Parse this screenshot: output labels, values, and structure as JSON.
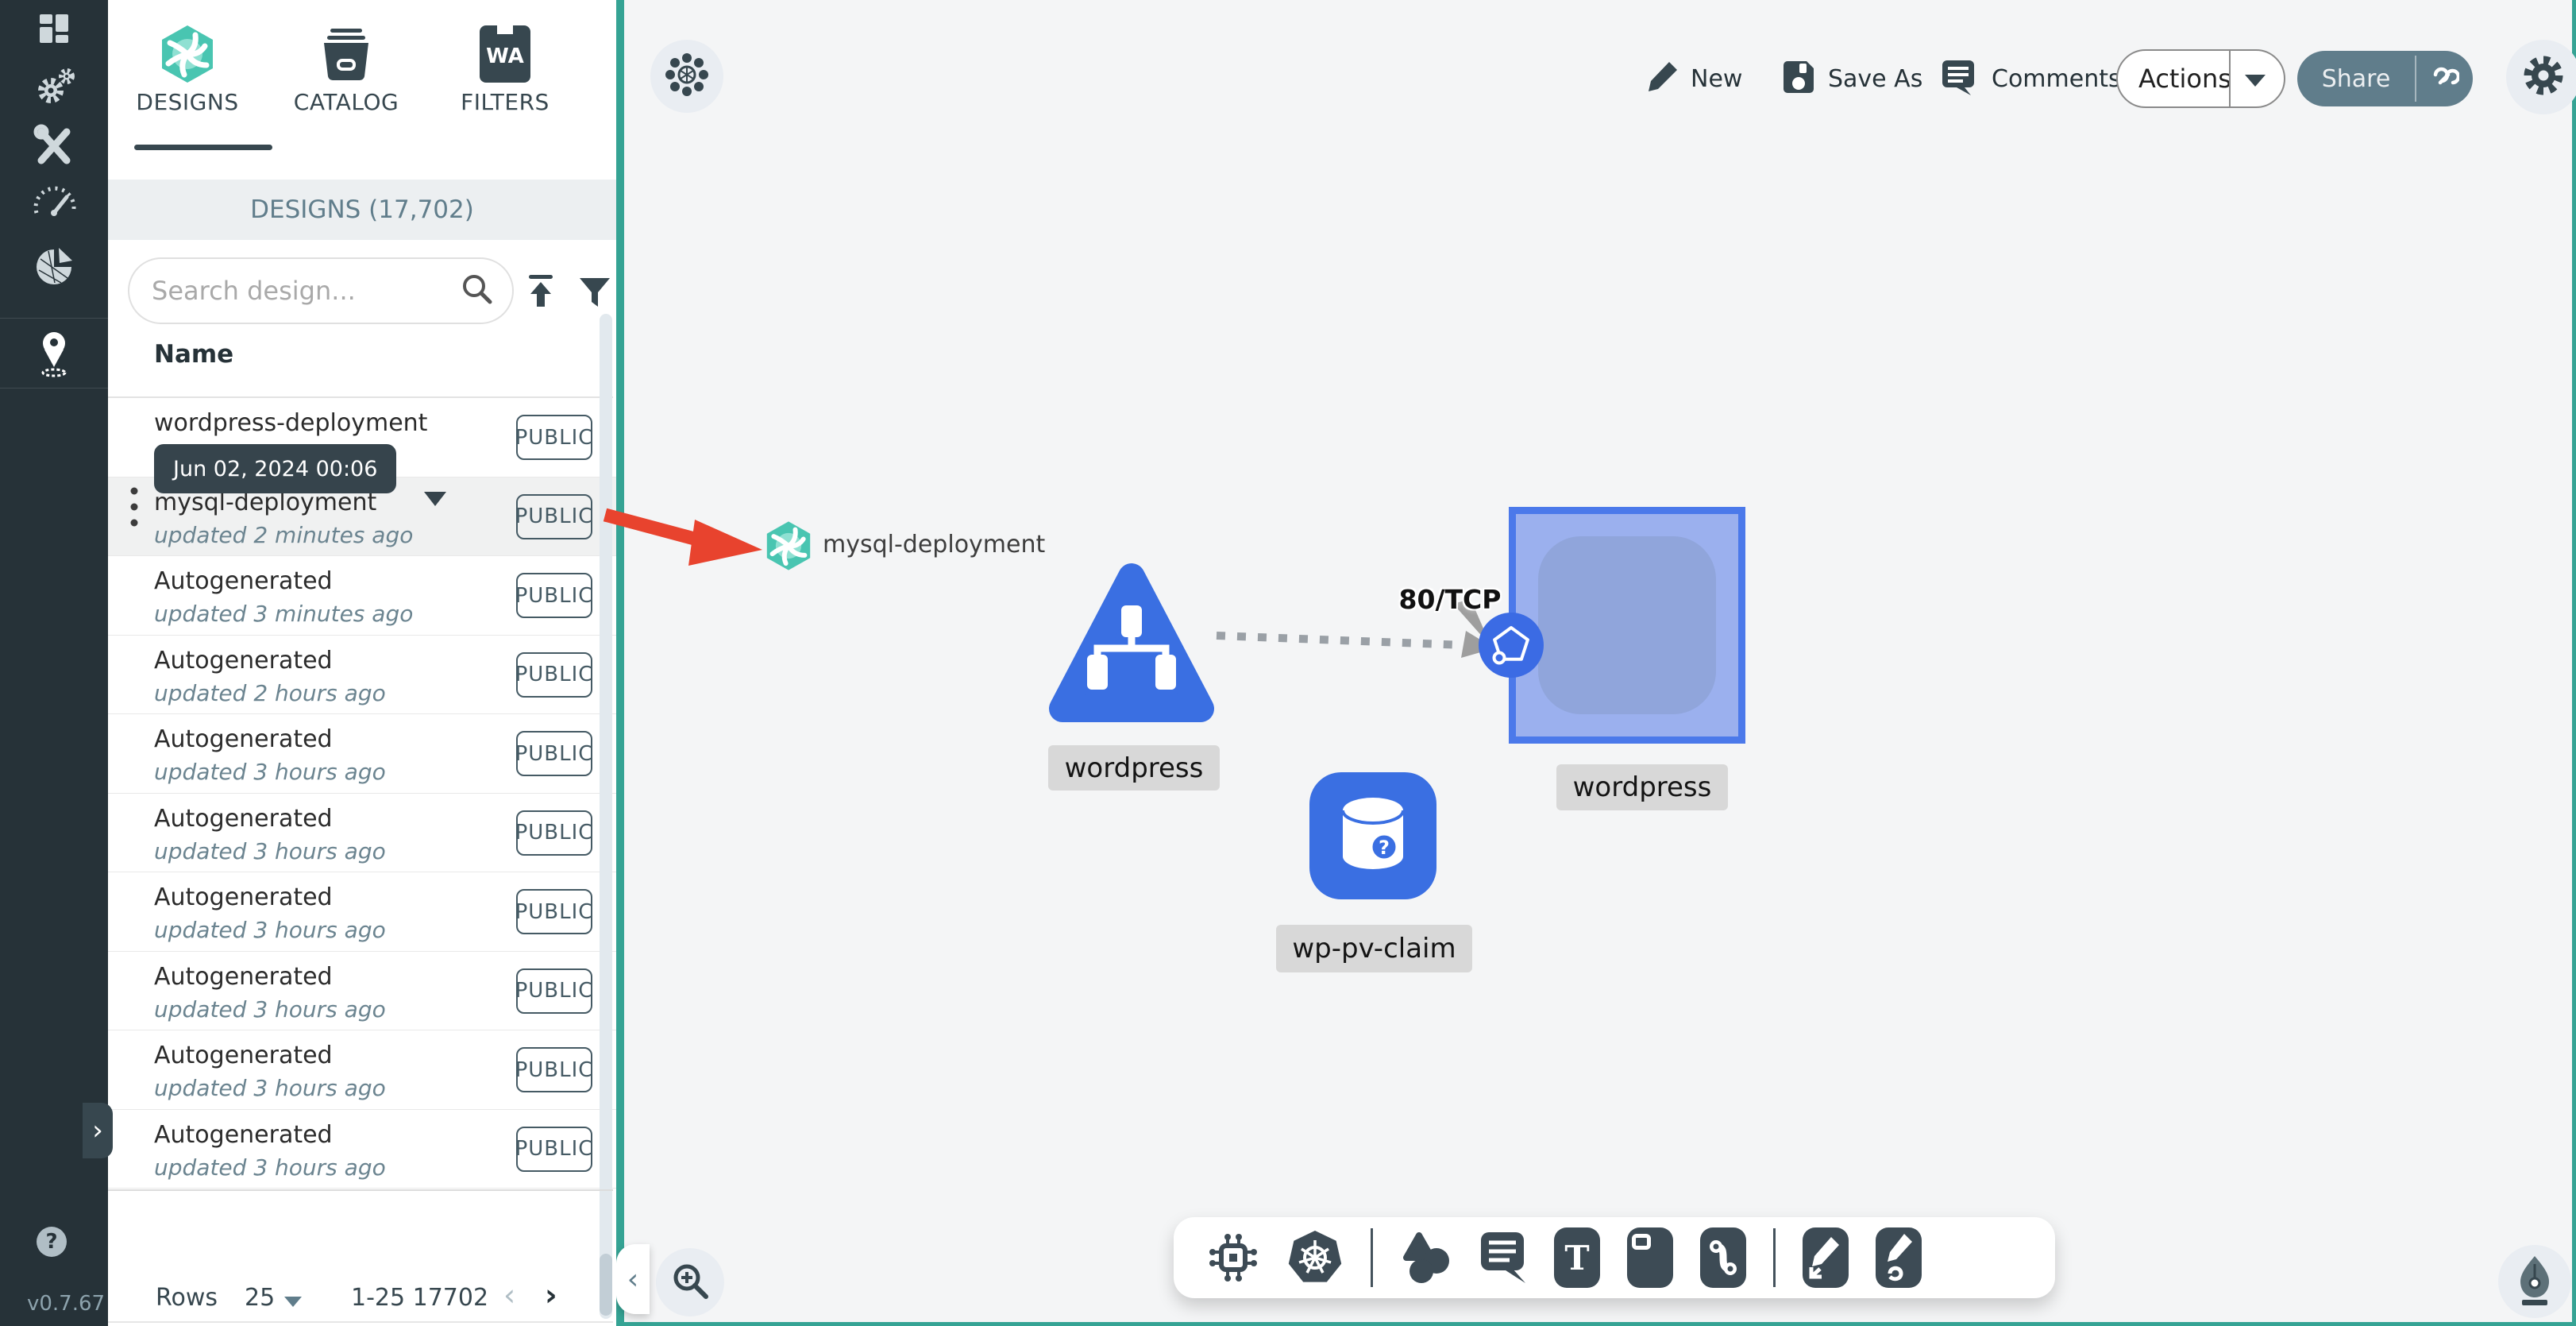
{
  "app": {
    "version": "v0.7.67"
  },
  "colors": {
    "teal_border": "#35a394",
    "sidebar_bg": "#263238",
    "k8s_blue": "#3a6fe2",
    "badge_blue": "#3b6be4",
    "red_arrow": "#e8432e",
    "share_button": "#607d8b",
    "canvas_bg": "#f4f5f6"
  },
  "sidebar": {
    "items": [
      {
        "icon": "dashboard-icon"
      },
      {
        "icon": "lifecycle-gears-icon"
      },
      {
        "icon": "configuration-tools-icon"
      },
      {
        "icon": "performance-gauge-icon"
      },
      {
        "icon": "extensions-pie-icon"
      },
      {
        "icon": "kanvas-pin-icon",
        "active": true
      }
    ],
    "help_glyph": "?",
    "expand_glyph": "›"
  },
  "panel": {
    "tabs": [
      {
        "label": "DESIGNS",
        "icon": "meshery-swirl-icon",
        "active": true
      },
      {
        "label": "CATALOG",
        "icon": "catalog-archive-icon"
      },
      {
        "label": "FILTERS",
        "icon": "wasm-filter-icon",
        "badge_glyph": "WA"
      }
    ],
    "header": "DESIGNS (17,702)",
    "search_placeholder": "Search design...",
    "column_name": "Name",
    "tooltip": "Jun 02, 2024 00:06",
    "rows": [
      {
        "name": "wordpress-deployment",
        "updated": "",
        "badge": "PUBLIC",
        "selected": false
      },
      {
        "name": "mysql-deployment",
        "updated": "updated 2 minutes ago",
        "badge": "PUBLIC",
        "selected": true
      },
      {
        "name": "Autogenerated",
        "updated": "updated 3 minutes ago",
        "badge": "PUBLIC",
        "selected": false
      },
      {
        "name": "Autogenerated",
        "updated": "updated 2 hours ago",
        "badge": "PUBLIC",
        "selected": false
      },
      {
        "name": "Autogenerated",
        "updated": "updated 3 hours ago",
        "badge": "PUBLIC",
        "selected": false
      },
      {
        "name": "Autogenerated",
        "updated": "updated 3 hours ago",
        "badge": "PUBLIC",
        "selected": false
      },
      {
        "name": "Autogenerated",
        "updated": "updated 3 hours ago",
        "badge": "PUBLIC",
        "selected": false
      },
      {
        "name": "Autogenerated",
        "updated": "updated 3 hours ago",
        "badge": "PUBLIC",
        "selected": false
      },
      {
        "name": "Autogenerated",
        "updated": "updated 3 hours ago",
        "badge": "PUBLIC",
        "selected": false
      },
      {
        "name": "Autogenerated",
        "updated": "updated 3 hours ago",
        "badge": "PUBLIC",
        "selected": false
      }
    ],
    "pagination": {
      "rows_label": "Rows",
      "per_page": "25",
      "range": "1-25 17702",
      "prev_glyph": "‹",
      "next_glyph": "›"
    }
  },
  "topbar": {
    "new": "New",
    "save_as": "Save As",
    "comments": "Comments",
    "actions": "Actions",
    "share": "Share"
  },
  "canvas": {
    "collapse_glyph": "‹",
    "nodes": {
      "mysql": {
        "label": "mysql-deployment",
        "icon": "meshery-swirl-icon"
      },
      "service": {
        "label": "wordpress",
        "icon": "k8s-service-triangle-icon"
      },
      "deployment": {
        "label": "wordpress",
        "icon": "k8s-deployment-square",
        "badge_icon": "k8s-pod-pentagon-badge"
      },
      "pvc": {
        "label": "wp-pv-claim",
        "icon": "volume-cylinder-icon",
        "badge_glyph": "?"
      }
    },
    "edge": {
      "label": "80/TCP"
    }
  },
  "bottom_toolbar": {
    "text_glyph": "T",
    "icons": [
      "component-chip-icon",
      "kubernetes-icon",
      "shapes-icon",
      "annotation-bubble-icon",
      "text-tool-icon",
      "note-tool-icon",
      "link-tool-icon",
      "edge-pen-icon",
      "doodle-pencil-icon"
    ]
  }
}
